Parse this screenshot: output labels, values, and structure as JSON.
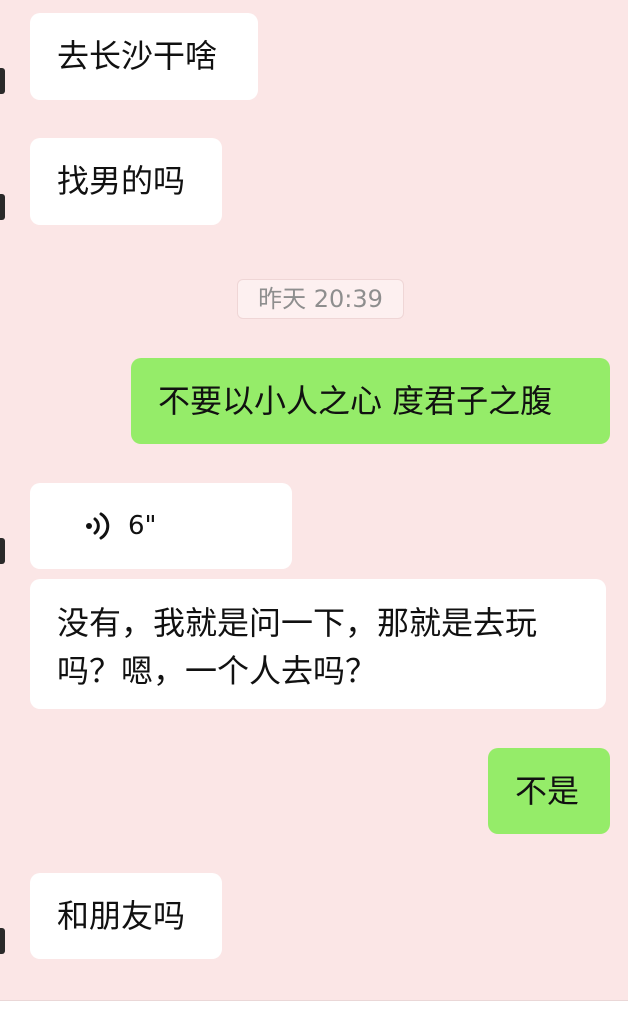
{
  "chat": {
    "messages": [
      {
        "side": "left",
        "text": "去长沙干啥"
      },
      {
        "side": "left",
        "text": "找男的吗"
      },
      {
        "side": "right",
        "text": "不要以小人之心 度君子之腹"
      },
      {
        "side": "left",
        "type": "voice",
        "duration": "6\""
      },
      {
        "side": "left",
        "text": "没有，我就是问一下，那就是去玩",
        "text2": "吗？嗯，一个人去吗？"
      },
      {
        "side": "right",
        "text": "不是"
      },
      {
        "side": "left",
        "text": "和朋友吗"
      }
    ],
    "timestamp": "昨天 20:39"
  },
  "icons": {
    "voice": "voice-wave-icon"
  },
  "colors": {
    "background": "#fbe6e6",
    "incoming_bubble": "#ffffff",
    "outgoing_bubble": "#95ec69",
    "timestamp_text": "#8e8e8e"
  }
}
